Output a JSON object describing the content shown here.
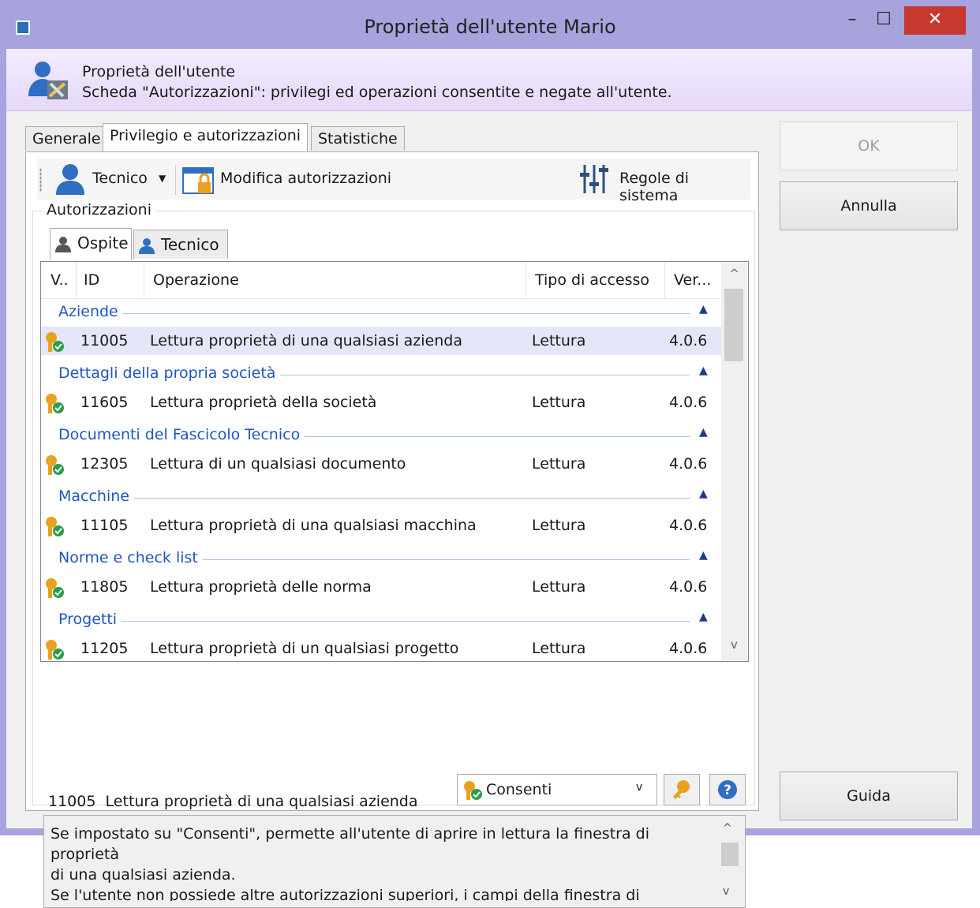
{
  "window": {
    "title": "Proprietà dell'utente Mario",
    "controls": {
      "minimize": "–",
      "maximize": "☐",
      "close": "✕"
    }
  },
  "header": {
    "title": "Proprietà dell'utente",
    "subtitle": "Scheda \"Autorizzazioni\": privilegi ed operazioni consentite e negate all'utente.",
    "icon": "user-settings-icon"
  },
  "tabs": [
    {
      "label": "Generale",
      "active": false
    },
    {
      "label": "Privilegio e autorizzazioni",
      "active": true
    },
    {
      "label": "Statistiche",
      "active": false
    }
  ],
  "toolbar": {
    "user_label": "Tecnico",
    "modify_label": "Modifica autorizzazioni",
    "rules_label": "Regole di sistema"
  },
  "permissions": {
    "group_label": "Autorizzazioni",
    "subtabs": [
      {
        "label": "Ospite",
        "active": true
      },
      {
        "label": "Tecnico",
        "active": false
      }
    ],
    "columns": {
      "v": "V..",
      "id": "ID",
      "operation": "Operazione",
      "access": "Tipo di accesso",
      "version": "Ver..."
    },
    "groups": [
      {
        "name": "Aziende",
        "row": {
          "id": "11005",
          "operation": "Lettura proprietà di una qualsiasi azienda",
          "access": "Lettura",
          "version": "4.0.6",
          "selected": true
        }
      },
      {
        "name": "Dettagli della propria società",
        "row": {
          "id": "11605",
          "operation": "Lettura proprietà della società",
          "access": "Lettura",
          "version": "4.0.6"
        }
      },
      {
        "name": "Documenti del Fascicolo Tecnico",
        "row": {
          "id": "12305",
          "operation": "Lettura di un qualsiasi documento",
          "access": "Lettura",
          "version": "4.0.6"
        }
      },
      {
        "name": "Macchine",
        "row": {
          "id": "11105",
          "operation": "Lettura proprietà di una qualsiasi macchina",
          "access": "Lettura",
          "version": "4.0.6"
        }
      },
      {
        "name": "Norme e check list",
        "row": {
          "id": "11805",
          "operation": "Lettura proprietà delle norma",
          "access": "Lettura",
          "version": "4.0.6"
        }
      },
      {
        "name": "Progetti",
        "row": {
          "id": "11205",
          "operation": "Lettura proprietà di un qualsiasi progetto",
          "access": "Lettura",
          "version": "4.0.6"
        }
      }
    ]
  },
  "selected": {
    "id": "11005",
    "operation": "Lettura proprietà di una qualsiasi azienda",
    "permission": "Consenti"
  },
  "description": "Se impostato su \"Consenti\", permette all'utente di aprire in lettura la finestra di proprietà\ndi una qualsiasi azienda.\nSe l'utente non possiede altre autorizzazioni superiori, i campi della finestra di proprietà",
  "buttons": {
    "ok": "OK",
    "cancel": "Annulla",
    "help": "Guida"
  },
  "colors": {
    "accent": "#1f56c0",
    "title_bar": "#a6a3dd",
    "close": "#c7392f",
    "header_bg": "#ece2fb"
  }
}
